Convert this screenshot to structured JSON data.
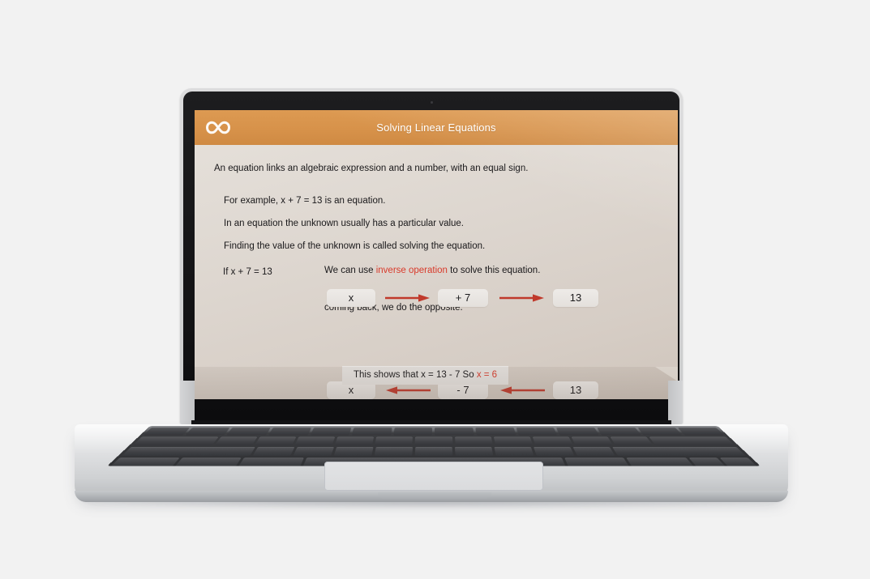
{
  "background_color": "#f2f2f2",
  "device": {
    "type": "laptop-mockup",
    "body_color": "#d5d6d8",
    "bezel_color": "#141416"
  },
  "slide": {
    "header": {
      "title": "Solving Linear Equations",
      "background_color": "#d7924a",
      "title_color": "#ffffff",
      "logo_icon": "infinity-icon"
    },
    "background_color": "#ddd6cf",
    "body": {
      "lead": "An equation links an algebraic expression and a number, with an equal sign.",
      "paragraphs": [
        "For example, x + 7 = 13 is an equation.",
        "In an equation the unknown usually has a particular value.",
        "Finding the value of the unknown is called solving the equation."
      ],
      "if_label": "If x + 7 = 13",
      "forward": {
        "intro_prefix": "We can use ",
        "intro_highlight": "inverse operation",
        "intro_suffix": " to solve this equation.",
        "highlight_color": "#d93a2b",
        "start_box": "x",
        "operation_box": "+ 7",
        "result_box": "13",
        "arrow_direction": "right",
        "arrow_color": "#c0392b"
      },
      "backward": {
        "intro": "coming back, we do the opposite.",
        "start_box": "x",
        "operation_box": "- 7",
        "result_box": "13",
        "arrow_direction": "left",
        "arrow_color": "#c0392b"
      },
      "conclusion": {
        "prefix": "This shows that  x = 13 - 7 So  ",
        "answer": "x = 6",
        "answer_color": "#d93a2b",
        "background_color": "#e7e4e1"
      }
    }
  }
}
